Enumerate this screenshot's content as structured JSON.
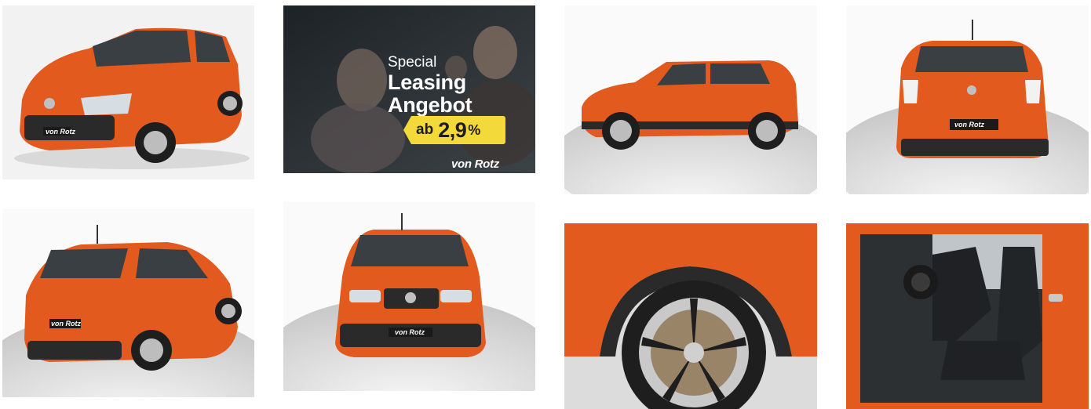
{
  "promo": {
    "special": "Special",
    "line1": "Leasing",
    "line2": "Angebot",
    "badge_prefix": "ab",
    "badge_rate": "2,9",
    "badge_unit": "%",
    "brand": "von Rotz"
  },
  "plate": "von Rotz",
  "colors": {
    "car_body": "#e25a1e",
    "car_dark": "#2a2a2a",
    "badge_yellow": "#f4d93a",
    "studio_bg": "#ececec"
  },
  "tiles": [
    {
      "name": "photo-front-three-quarter"
    },
    {
      "name": "promo-leasing-banner"
    },
    {
      "name": "photo-side-profile"
    },
    {
      "name": "photo-rear"
    },
    {
      "name": "photo-rear-three-quarter"
    },
    {
      "name": "photo-front"
    },
    {
      "name": "photo-wheel-detail"
    },
    {
      "name": "photo-interior-front-seats"
    }
  ]
}
